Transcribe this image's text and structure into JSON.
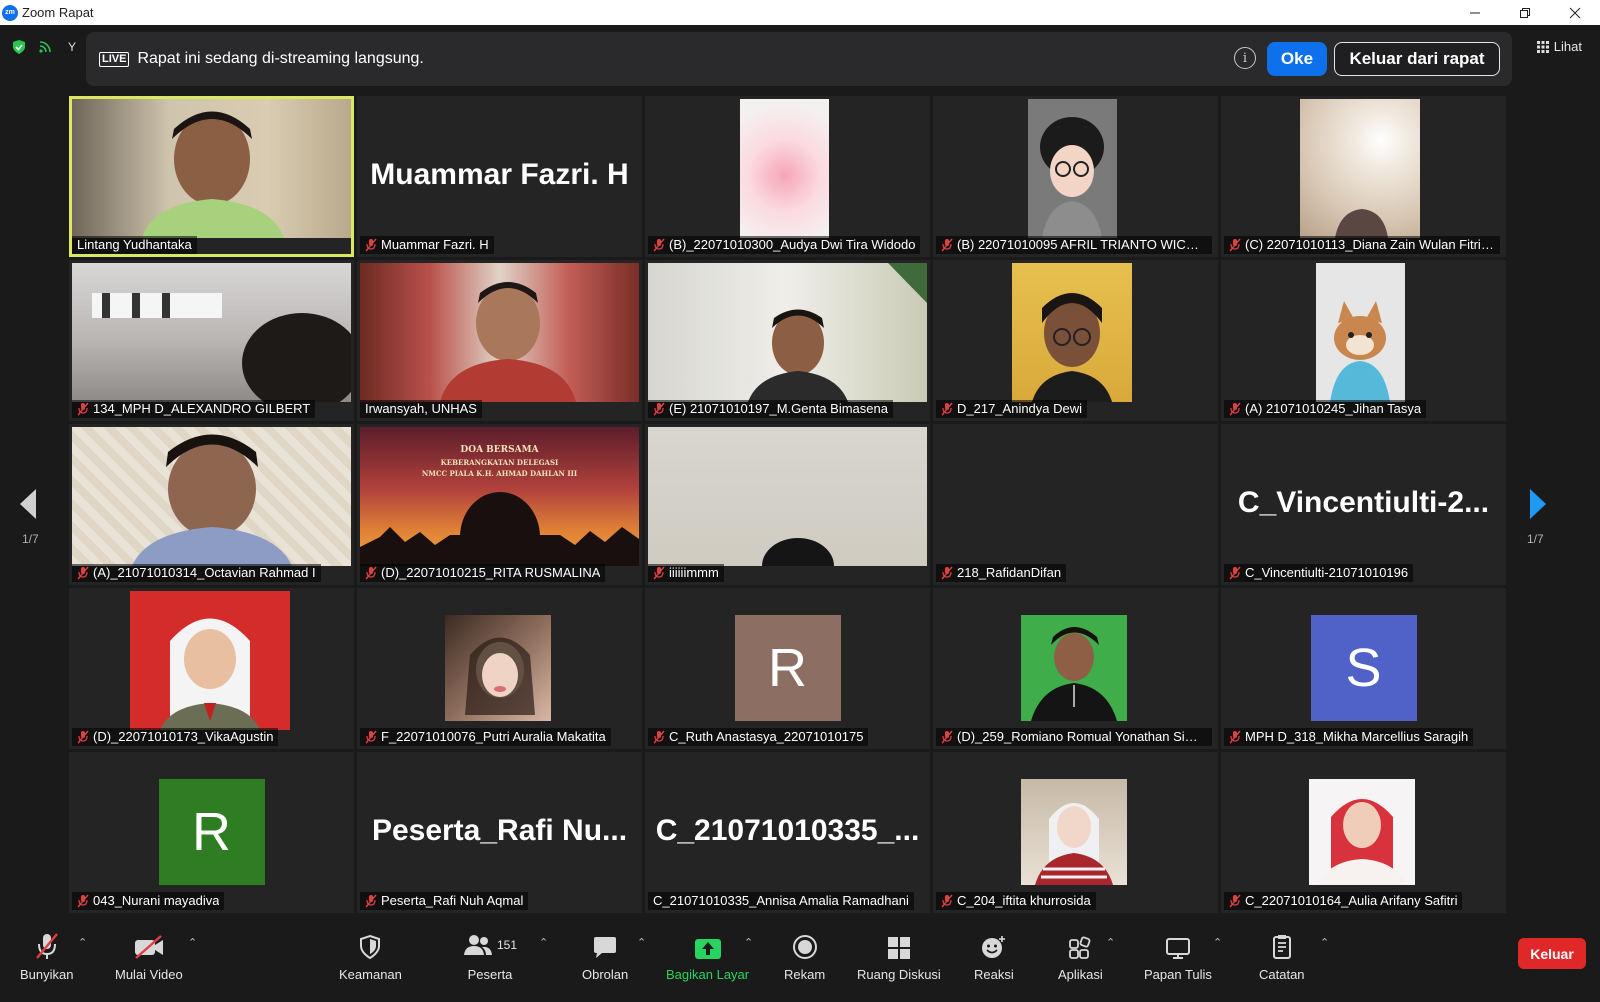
{
  "window": {
    "title": "Zoom Rapat",
    "logo_text": "zm"
  },
  "banner": {
    "live_label": "LIVE",
    "message": "Rapat ini sedang di-streaming langsung.",
    "info_label": "i",
    "ok_label": "Oke",
    "leave_label": "Keluar dari rapat"
  },
  "topbar": {
    "view_label": "Lihat",
    "truncated_char": "Y"
  },
  "page_indicator": {
    "left": "1/7",
    "right": "1/7"
  },
  "participants": [
    {
      "name": "Lintang Yudhantaka",
      "muted": false,
      "mode": "video",
      "active": true
    },
    {
      "name": "Muammar Fazri. H",
      "muted": true,
      "mode": "name",
      "big_name": "Muammar Fazri. H"
    },
    {
      "name": "(B)_22071010300_Audya Dwi Tira Widodo",
      "muted": true,
      "mode": "video"
    },
    {
      "name": "(B) 22071010095 AFRIL TRIANTO WICAKS...",
      "muted": true,
      "mode": "video"
    },
    {
      "name": "(C) 22071010113_Diana Zain Wulan Fitria...",
      "muted": true,
      "mode": "video"
    },
    {
      "name": "134_MPH D_ALEXANDRO GILBERT",
      "muted": true,
      "mode": "video"
    },
    {
      "name": "Irwansyah, UNHAS",
      "muted": false,
      "mode": "video"
    },
    {
      "name": "(E) 21071010197_M.Genta Bimasena",
      "muted": true,
      "mode": "video"
    },
    {
      "name": "D_217_Anindya Dewi",
      "muted": true,
      "mode": "video"
    },
    {
      "name": "(A) 21071010245_Jihan Tasya",
      "muted": true,
      "mode": "video"
    },
    {
      "name": "(A)_21071010314_Octavian Rahmad I",
      "muted": true,
      "mode": "video"
    },
    {
      "name": "(D)_22071010215_RITA RUSMALINA",
      "muted": true,
      "mode": "video",
      "poster_lines": [
        "DOA BERSAMA",
        "KEBERANGKATAN DELEGASI",
        "NMCC PIALA K.H. AHMAD DAHLAN III"
      ]
    },
    {
      "name": "iiiiiimmm",
      "muted": true,
      "mode": "video"
    },
    {
      "name": "218_RafidanDifan",
      "muted": true,
      "mode": "blank"
    },
    {
      "name": "C_Vincentiulti-21071010196",
      "muted": true,
      "mode": "name",
      "big_name": "C_Vincentiulti-2..."
    },
    {
      "name": "(D)_22071010173_VikaAgustin",
      "muted": true,
      "mode": "photo"
    },
    {
      "name": "F_22071010076_Putri Auralia Makatita",
      "muted": true,
      "mode": "photo"
    },
    {
      "name": "C_Ruth Anastasya_22071010175",
      "muted": true,
      "mode": "avatar",
      "initial": "R",
      "color": "#8c6e63"
    },
    {
      "name": "(D)_259_Romiano Romual Yonathan Sima...",
      "muted": true,
      "mode": "photo"
    },
    {
      "name": "MPH D_318_Mikha Marcellius Saragih",
      "muted": true,
      "mode": "avatar",
      "initial": "S",
      "color": "#5061c8"
    },
    {
      "name": "043_Nurani mayadiva",
      "muted": true,
      "mode": "avatar",
      "initial": "R",
      "color": "#2f7d22"
    },
    {
      "name": "Peserta_Rafi Nuh Aqmal",
      "muted": true,
      "mode": "name",
      "big_name": "Peserta_Rafi  Nu..."
    },
    {
      "name": "C_21071010335_Annisa Amalia Ramadhani",
      "muted": false,
      "mode": "name",
      "big_name": "C_21071010335_..."
    },
    {
      "name": "C_204_iftita khurrosida",
      "muted": true,
      "mode": "photo"
    },
    {
      "name": "C_22071010164_Aulia Arifany Safitri",
      "muted": true,
      "mode": "photo"
    }
  ],
  "toolbar": {
    "unmute": "Bunyikan",
    "start_video": "Mulai Video",
    "security": "Keamanan",
    "participants": "Peserta",
    "participants_count": "151",
    "chat": "Obrolan",
    "share_screen": "Bagikan Layar",
    "record": "Rekam",
    "breakout": "Ruang Diskusi",
    "reactions": "Reaksi",
    "apps": "Aplikasi",
    "whiteboard": "Papan Tulis",
    "notes": "Catatan",
    "leave": "Keluar"
  },
  "colors": {
    "accent": "#0e71eb",
    "active_speaker": "#d9e860",
    "share_green": "#27d45f",
    "leave_red": "#e02828",
    "mute_red": "#e04040"
  }
}
